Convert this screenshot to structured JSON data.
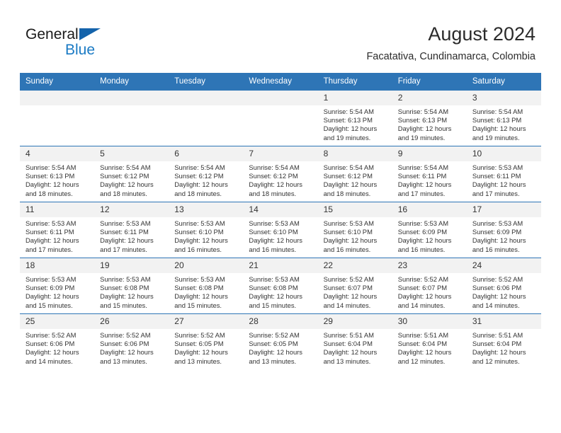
{
  "brand": {
    "line1": "General",
    "line2": "Blue",
    "triangle_color": "#1463ab",
    "line2_color": "#1a7ac4"
  },
  "header": {
    "title": "August 2024",
    "subtitle": "Facatativa, Cundinamarca, Colombia",
    "accent_color": "#2e75b6"
  },
  "calendar": {
    "weekday_headers": [
      "Sunday",
      "Monday",
      "Tuesday",
      "Wednesday",
      "Thursday",
      "Friday",
      "Saturday"
    ],
    "labels": {
      "sunrise": "Sunrise:",
      "sunset": "Sunset:",
      "daylight": "Daylight:"
    },
    "weeks": [
      [
        {
          "day": "",
          "blank": true
        },
        {
          "day": "",
          "blank": true
        },
        {
          "day": "",
          "blank": true
        },
        {
          "day": "",
          "blank": true
        },
        {
          "day": "1",
          "sunrise": "Sunrise: 5:54 AM",
          "sunset": "Sunset: 6:13 PM",
          "daylight1": "Daylight: 12 hours",
          "daylight2": "and 19 minutes."
        },
        {
          "day": "2",
          "sunrise": "Sunrise: 5:54 AM",
          "sunset": "Sunset: 6:13 PM",
          "daylight1": "Daylight: 12 hours",
          "daylight2": "and 19 minutes."
        },
        {
          "day": "3",
          "sunrise": "Sunrise: 5:54 AM",
          "sunset": "Sunset: 6:13 PM",
          "daylight1": "Daylight: 12 hours",
          "daylight2": "and 19 minutes."
        }
      ],
      [
        {
          "day": "4",
          "sunrise": "Sunrise: 5:54 AM",
          "sunset": "Sunset: 6:13 PM",
          "daylight1": "Daylight: 12 hours",
          "daylight2": "and 18 minutes."
        },
        {
          "day": "5",
          "sunrise": "Sunrise: 5:54 AM",
          "sunset": "Sunset: 6:12 PM",
          "daylight1": "Daylight: 12 hours",
          "daylight2": "and 18 minutes."
        },
        {
          "day": "6",
          "sunrise": "Sunrise: 5:54 AM",
          "sunset": "Sunset: 6:12 PM",
          "daylight1": "Daylight: 12 hours",
          "daylight2": "and 18 minutes."
        },
        {
          "day": "7",
          "sunrise": "Sunrise: 5:54 AM",
          "sunset": "Sunset: 6:12 PM",
          "daylight1": "Daylight: 12 hours",
          "daylight2": "and 18 minutes."
        },
        {
          "day": "8",
          "sunrise": "Sunrise: 5:54 AM",
          "sunset": "Sunset: 6:12 PM",
          "daylight1": "Daylight: 12 hours",
          "daylight2": "and 18 minutes."
        },
        {
          "day": "9",
          "sunrise": "Sunrise: 5:54 AM",
          "sunset": "Sunset: 6:11 PM",
          "daylight1": "Daylight: 12 hours",
          "daylight2": "and 17 minutes."
        },
        {
          "day": "10",
          "sunrise": "Sunrise: 5:53 AM",
          "sunset": "Sunset: 6:11 PM",
          "daylight1": "Daylight: 12 hours",
          "daylight2": "and 17 minutes."
        }
      ],
      [
        {
          "day": "11",
          "sunrise": "Sunrise: 5:53 AM",
          "sunset": "Sunset: 6:11 PM",
          "daylight1": "Daylight: 12 hours",
          "daylight2": "and 17 minutes."
        },
        {
          "day": "12",
          "sunrise": "Sunrise: 5:53 AM",
          "sunset": "Sunset: 6:11 PM",
          "daylight1": "Daylight: 12 hours",
          "daylight2": "and 17 minutes."
        },
        {
          "day": "13",
          "sunrise": "Sunrise: 5:53 AM",
          "sunset": "Sunset: 6:10 PM",
          "daylight1": "Daylight: 12 hours",
          "daylight2": "and 16 minutes."
        },
        {
          "day": "14",
          "sunrise": "Sunrise: 5:53 AM",
          "sunset": "Sunset: 6:10 PM",
          "daylight1": "Daylight: 12 hours",
          "daylight2": "and 16 minutes."
        },
        {
          "day": "15",
          "sunrise": "Sunrise: 5:53 AM",
          "sunset": "Sunset: 6:10 PM",
          "daylight1": "Daylight: 12 hours",
          "daylight2": "and 16 minutes."
        },
        {
          "day": "16",
          "sunrise": "Sunrise: 5:53 AM",
          "sunset": "Sunset: 6:09 PM",
          "daylight1": "Daylight: 12 hours",
          "daylight2": "and 16 minutes."
        },
        {
          "day": "17",
          "sunrise": "Sunrise: 5:53 AM",
          "sunset": "Sunset: 6:09 PM",
          "daylight1": "Daylight: 12 hours",
          "daylight2": "and 16 minutes."
        }
      ],
      [
        {
          "day": "18",
          "sunrise": "Sunrise: 5:53 AM",
          "sunset": "Sunset: 6:09 PM",
          "daylight1": "Daylight: 12 hours",
          "daylight2": "and 15 minutes."
        },
        {
          "day": "19",
          "sunrise": "Sunrise: 5:53 AM",
          "sunset": "Sunset: 6:08 PM",
          "daylight1": "Daylight: 12 hours",
          "daylight2": "and 15 minutes."
        },
        {
          "day": "20",
          "sunrise": "Sunrise: 5:53 AM",
          "sunset": "Sunset: 6:08 PM",
          "daylight1": "Daylight: 12 hours",
          "daylight2": "and 15 minutes."
        },
        {
          "day": "21",
          "sunrise": "Sunrise: 5:53 AM",
          "sunset": "Sunset: 6:08 PM",
          "daylight1": "Daylight: 12 hours",
          "daylight2": "and 15 minutes."
        },
        {
          "day": "22",
          "sunrise": "Sunrise: 5:52 AM",
          "sunset": "Sunset: 6:07 PM",
          "daylight1": "Daylight: 12 hours",
          "daylight2": "and 14 minutes."
        },
        {
          "day": "23",
          "sunrise": "Sunrise: 5:52 AM",
          "sunset": "Sunset: 6:07 PM",
          "daylight1": "Daylight: 12 hours",
          "daylight2": "and 14 minutes."
        },
        {
          "day": "24",
          "sunrise": "Sunrise: 5:52 AM",
          "sunset": "Sunset: 6:06 PM",
          "daylight1": "Daylight: 12 hours",
          "daylight2": "and 14 minutes."
        }
      ],
      [
        {
          "day": "25",
          "sunrise": "Sunrise: 5:52 AM",
          "sunset": "Sunset: 6:06 PM",
          "daylight1": "Daylight: 12 hours",
          "daylight2": "and 14 minutes."
        },
        {
          "day": "26",
          "sunrise": "Sunrise: 5:52 AM",
          "sunset": "Sunset: 6:06 PM",
          "daylight1": "Daylight: 12 hours",
          "daylight2": "and 13 minutes."
        },
        {
          "day": "27",
          "sunrise": "Sunrise: 5:52 AM",
          "sunset": "Sunset: 6:05 PM",
          "daylight1": "Daylight: 12 hours",
          "daylight2": "and 13 minutes."
        },
        {
          "day": "28",
          "sunrise": "Sunrise: 5:52 AM",
          "sunset": "Sunset: 6:05 PM",
          "daylight1": "Daylight: 12 hours",
          "daylight2": "and 13 minutes."
        },
        {
          "day": "29",
          "sunrise": "Sunrise: 5:51 AM",
          "sunset": "Sunset: 6:04 PM",
          "daylight1": "Daylight: 12 hours",
          "daylight2": "and 13 minutes."
        },
        {
          "day": "30",
          "sunrise": "Sunrise: 5:51 AM",
          "sunset": "Sunset: 6:04 PM",
          "daylight1": "Daylight: 12 hours",
          "daylight2": "and 12 minutes."
        },
        {
          "day": "31",
          "sunrise": "Sunrise: 5:51 AM",
          "sunset": "Sunset: 6:04 PM",
          "daylight1": "Daylight: 12 hours",
          "daylight2": "and 12 minutes."
        }
      ]
    ]
  }
}
